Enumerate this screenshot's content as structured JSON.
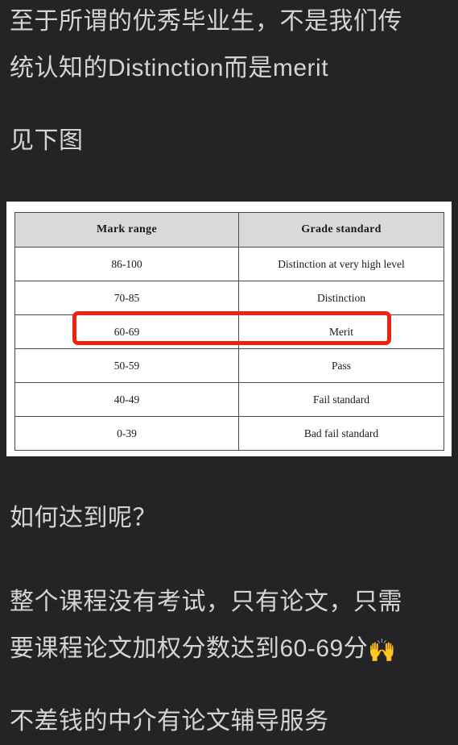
{
  "post": {
    "paragraphs": [
      {
        "id": "p1",
        "lines": [
          "至于所谓的优秀毕业生，不是我们传",
          "统认知的Distinction而是merit"
        ]
      },
      {
        "id": "p2",
        "lines": [
          "见下图"
        ]
      },
      {
        "id": "p3",
        "lines": [
          "如何达到呢？"
        ]
      },
      {
        "id": "p4",
        "lines": [
          "整个课程没有考试，只有论文，只需",
          "要课程论文加权分数达到60-69分"
        ],
        "emoji": "🙌"
      },
      {
        "id": "p5",
        "lines": [
          "不差钱的中介有论文辅导服务"
        ]
      }
    ],
    "text_color": "#d3d4d6",
    "background_color": "#242426"
  },
  "table": {
    "headers": [
      "Mark range",
      "Grade standard"
    ],
    "rows": [
      {
        "mark_range": "86-100",
        "grade_standard": "Distinction at very high level"
      },
      {
        "mark_range": "70-85",
        "grade_standard": "Distinction"
      },
      {
        "mark_range": "60-69",
        "grade_standard": "Merit"
      },
      {
        "mark_range": "50-59",
        "grade_standard": "Pass"
      },
      {
        "mark_range": "40-49",
        "grade_standard": "Fail standard"
      },
      {
        "mark_range": "0-39",
        "grade_standard": "Bad fail standard"
      }
    ],
    "highlighted_row_index": 2,
    "highlight_color": "#ee2211",
    "header_background": "#d9d9d9",
    "cell_background": "#ffffff",
    "border_color": "#4a4a4a"
  }
}
